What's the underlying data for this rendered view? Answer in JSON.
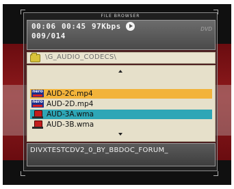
{
  "header": {
    "title": "FILE BROWSER"
  },
  "playback": {
    "elapsed": "00:06",
    "total": "00:45",
    "bitrate": "97Kbps",
    "track_position": "009/014",
    "logo_text": "DVD"
  },
  "path": {
    "value": "\\G_AUDIO_CODECS\\"
  },
  "files": [
    {
      "name": "AUD-2C.mp4",
      "type": "nero",
      "state": "highlighted"
    },
    {
      "name": "AUD-2D.mp4",
      "type": "nero",
      "state": "normal"
    },
    {
      "name": "AUD-3A.wma",
      "type": "audio",
      "state": "selected"
    },
    {
      "name": "AUD-3B.wma",
      "type": "audio",
      "state": "normal"
    }
  ],
  "icons": {
    "nero": "nero-file-icon",
    "audio": "audio-file-icon",
    "folder": "folder-icon",
    "play": "play-icon"
  },
  "status": {
    "text": "DIVXTESTCDV2_0_BY_BBDOC_FORUM_"
  },
  "colors": {
    "highlight": "#f2b33a",
    "selected": "#2ea6b6",
    "panel_background": "#e6e0ca"
  }
}
